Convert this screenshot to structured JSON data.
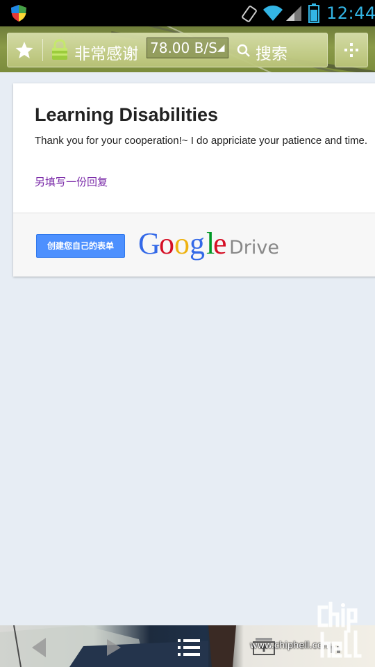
{
  "status_bar": {
    "time": "12:44",
    "icons": [
      "shield-icon",
      "auto-rotate-icon",
      "wifi-icon",
      "signal-icon",
      "battery-icon"
    ],
    "accent_color": "#33b5e5"
  },
  "browser": {
    "page_title": "非常感谢",
    "speed_indicator": "78.00 B/S",
    "search_label": "搜索",
    "icons": [
      "star-icon",
      "lock-icon",
      "search-icon",
      "overflow-menu-icon"
    ]
  },
  "page": {
    "heading": "Learning Disabilities",
    "message": "Thank you for your cooperation!~ I do appriciate your patience and time.",
    "another_response_link": "另填写一份回复",
    "create_form_button": "创建您自己的表单",
    "brand": {
      "google_letters": [
        "G",
        "o",
        "o",
        "g",
        "l",
        "e"
      ],
      "google_colors": [
        "#3369e8",
        "#d50f25",
        "#eeb211",
        "#3369e8",
        "#009925",
        "#d50f25"
      ],
      "product": "Drive"
    },
    "link_color": "#7a2aa8",
    "button_color": "#4d90fe"
  },
  "nav_bar": {
    "icons": [
      "back-icon",
      "forward-icon",
      "bookmarks-list-icon",
      "tabs-icon",
      "more-icon"
    ]
  },
  "watermark": {
    "url": "www.chiphell.com",
    "logo_text": "chip hell"
  }
}
